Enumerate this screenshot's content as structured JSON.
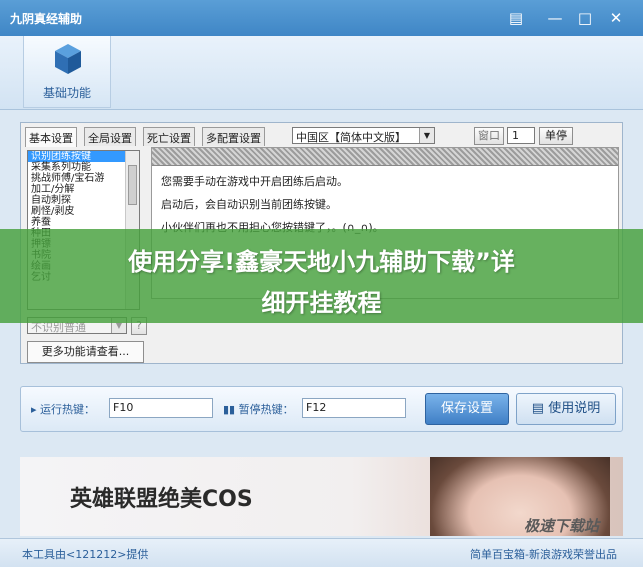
{
  "window": {
    "title": "九阴真经辅助",
    "minimize_icon": "—",
    "maximize_icon": "□",
    "close_icon": "✕",
    "feedback_icon": "▤"
  },
  "toolbar": {
    "basic_label": "基础功能"
  },
  "tabs": [
    "基本设置",
    "全局设置",
    "死亡设置",
    "多配置设置"
  ],
  "server_select": {
    "value": "中国区【简体中文版】"
  },
  "window_counter": {
    "label": "窗口",
    "value": "1"
  },
  "single_stop_label": "单停",
  "function_list": {
    "items": [
      "识别团练按键",
      "采集系列功能",
      "挑战师傅/宝石游",
      "加工/分解",
      "自动刺探",
      "刷怪/剥皮",
      "养蚕",
      "种田",
      "押镖",
      "书院",
      "绘画",
      "乞讨"
    ],
    "selected_index": 0
  },
  "recognize_select": {
    "value": "不识别普通"
  },
  "help_button": "?",
  "more_functions_label": "更多功能请查看...",
  "description": {
    "lines": [
      "您需要手动在游戏中开启团练后启动。",
      "启动后，会自动识别当前团练按键。",
      "小伙伴们再也不用担心您按错键了，。(∩_∩)。"
    ]
  },
  "hotkeys": {
    "run_label": "运行热键：",
    "run_value": "F10",
    "pause_label": "暂停热键：",
    "pause_value": "F12",
    "save_label": "保存设置",
    "help_label": "使用说明"
  },
  "ad": {
    "text": "英雄联盟绝美COS"
  },
  "status": {
    "left": "本工具由<121212>提供",
    "right": "简单百宝箱-新浪游戏荣誉出品"
  },
  "overlay": {
    "line1": "使用分享!鑫豪天地小九辅助下载”详",
    "line2": "细开挂教程"
  },
  "watermark": "极速下载站"
}
